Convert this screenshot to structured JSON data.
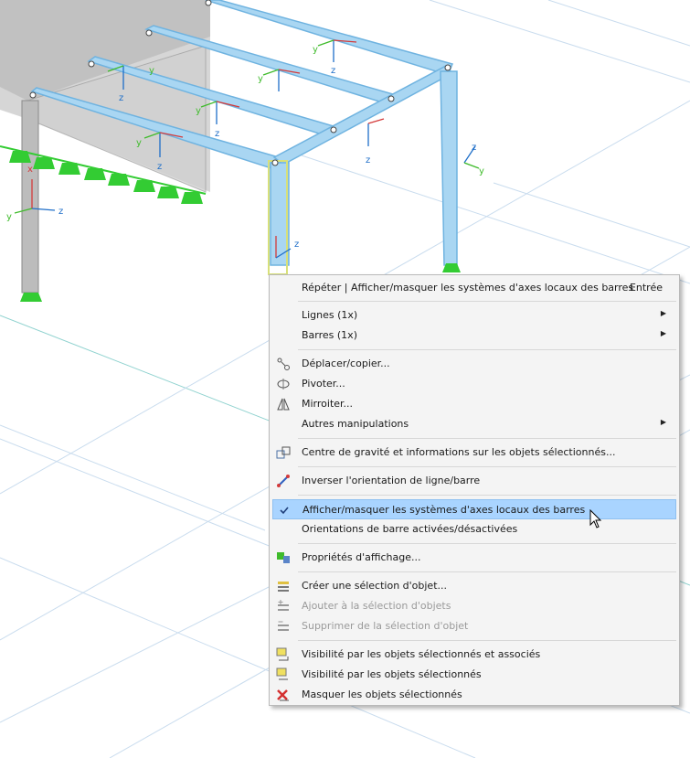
{
  "menu": {
    "items": [
      {
        "id": "repeat",
        "label": "Répéter | Afficher/masquer les systèmes d'axes locaux des barres",
        "shortcut": "Entrée",
        "icon": "none-icon"
      },
      {
        "id": "lines",
        "label": "Lignes (1x)",
        "submenu": true,
        "icon": "none-icon"
      },
      {
        "id": "members",
        "label": "Barres (1x)",
        "submenu": true,
        "icon": "none-icon"
      },
      {
        "id": "move",
        "label": "Déplacer/copier...",
        "icon": "move-copy-icon"
      },
      {
        "id": "rotate",
        "label": "Pivoter...",
        "icon": "rotate-icon"
      },
      {
        "id": "mirror",
        "label": "Mirroiter...",
        "icon": "mirror-icon"
      },
      {
        "id": "other",
        "label": "Autres manipulations",
        "submenu": true,
        "icon": "none-icon"
      },
      {
        "id": "centroid",
        "label": "Centre de gravité et informations sur les objets sélectionnés...",
        "icon": "center-of-gravity-icon"
      },
      {
        "id": "reverse",
        "label": "Inverser l'orientation de ligne/barre",
        "icon": "reverse-orientation-icon"
      },
      {
        "id": "toggle_axes",
        "label": "Afficher/masquer les systèmes d'axes locaux des barres",
        "checked": true,
        "highlighted": true,
        "icon": "checkmark-icon"
      },
      {
        "id": "orientations",
        "label": "Orientations de barre activées/désactivées",
        "icon": "none-icon"
      },
      {
        "id": "display_props",
        "label": "Propriétés d'affichage...",
        "icon": "display-properties-icon"
      },
      {
        "id": "create_sel",
        "label": "Créer une sélection d'objet...",
        "icon": "create-selection-icon"
      },
      {
        "id": "add_sel",
        "label": "Ajouter à la sélection d'objets",
        "disabled": true,
        "icon": "add-selection-icon"
      },
      {
        "id": "remove_sel",
        "label": "Supprimer de la sélection d'objet",
        "disabled": true,
        "icon": "remove-selection-icon"
      },
      {
        "id": "vis_assoc",
        "label": "Visibilité par les objets sélectionnés et associés",
        "icon": "visibility-associated-icon"
      },
      {
        "id": "vis_sel",
        "label": "Visibilité par les objets sélectionnés",
        "icon": "visibility-selected-icon"
      },
      {
        "id": "hide_sel",
        "label": "Masquer les objets sélectionnés",
        "icon": "hide-objects-icon"
      }
    ]
  },
  "axes": {
    "x": "x",
    "y": "y",
    "z": "z"
  },
  "colors": {
    "member": "#a9d6f2",
    "member_edge": "#6fb3e0",
    "grid": "#c9dcee",
    "support": "#33cc33",
    "menu_highlight": "#a9d4ff"
  }
}
